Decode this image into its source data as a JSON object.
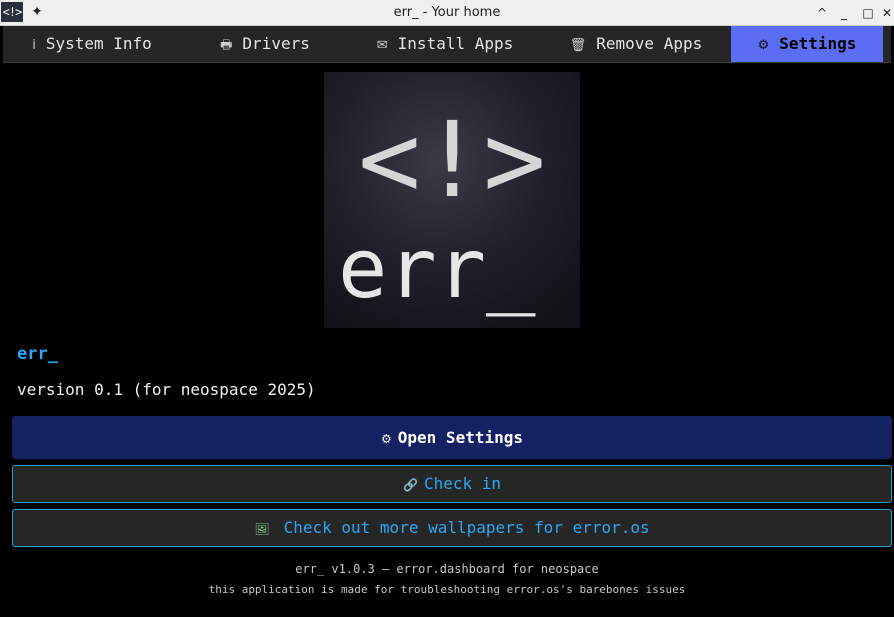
{
  "window": {
    "app_icon_text": "<!>",
    "title": "err_ - Your home",
    "controls": [
      "^",
      "_",
      "□",
      "✕"
    ]
  },
  "tabs": [
    {
      "icon": "i",
      "label": "System Info",
      "icon_name": "info-icon"
    },
    {
      "icon": "🖶",
      "label": "Drivers",
      "icon_name": "printer-icon"
    },
    {
      "icon": "✉",
      "label": "Install Apps",
      "icon_name": "envelope-icon"
    },
    {
      "icon": "🗑",
      "label": "Remove Apps",
      "icon_name": "trash-icon"
    },
    {
      "icon": "⚙",
      "label": "Settings",
      "icon_name": "gear-icon",
      "active": true
    }
  ],
  "logo": {
    "symbol": "<!>",
    "wordmark": "err_"
  },
  "about": {
    "name": "err_",
    "version": "version 0.1 (for neospace 2025)"
  },
  "buttons": {
    "open_settings": {
      "icon": "⚙",
      "label": "Open Settings"
    },
    "check_in": {
      "icon": "🔗",
      "label": "Check in"
    },
    "wallpapers": {
      "icon": "🖼",
      "label": "Check out more wallpapers for error.os"
    }
  },
  "footer": {
    "line1": "err_ v1.0.3 — error.dashboard for neospace",
    "line2": "this application is made for troubleshooting error.os's barebones issues"
  },
  "colors": {
    "accent_tab": "#5a6df3",
    "primary_button": "#142264",
    "link_blue": "#2aa7f4"
  }
}
